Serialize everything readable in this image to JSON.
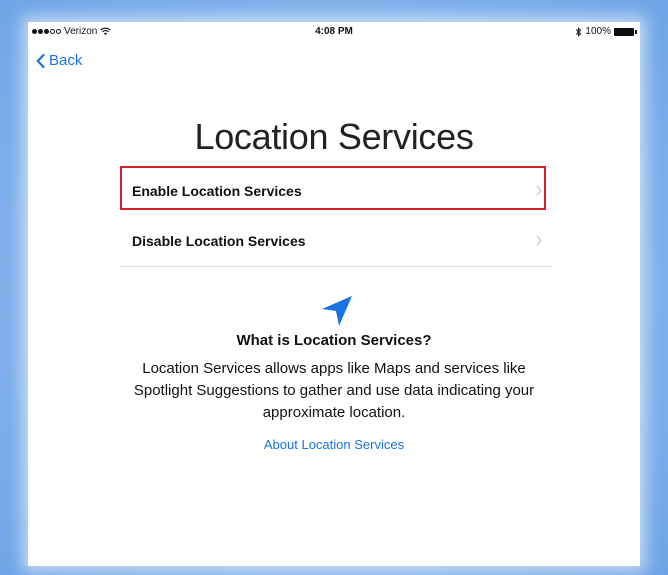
{
  "status_bar": {
    "carrier": "Verizon",
    "time": "4:08 PM",
    "battery": "100%"
  },
  "nav": {
    "back_label": "Back"
  },
  "page": {
    "title": "Location Services"
  },
  "options": [
    {
      "label": "Enable Location Services",
      "highlighted": true
    },
    {
      "label": "Disable Location Services",
      "highlighted": false
    }
  ],
  "info": {
    "icon": "location-arrow-icon",
    "heading": "What is Location Services?",
    "body": "Location Services allows apps like Maps and services like Spotlight Suggestions to gather and use data indicating your approximate location.",
    "link": "About Location Services"
  },
  "colors": {
    "accent": "#1a73e0",
    "highlight": "#d61f26",
    "background_frame": "#7eb3ec"
  }
}
